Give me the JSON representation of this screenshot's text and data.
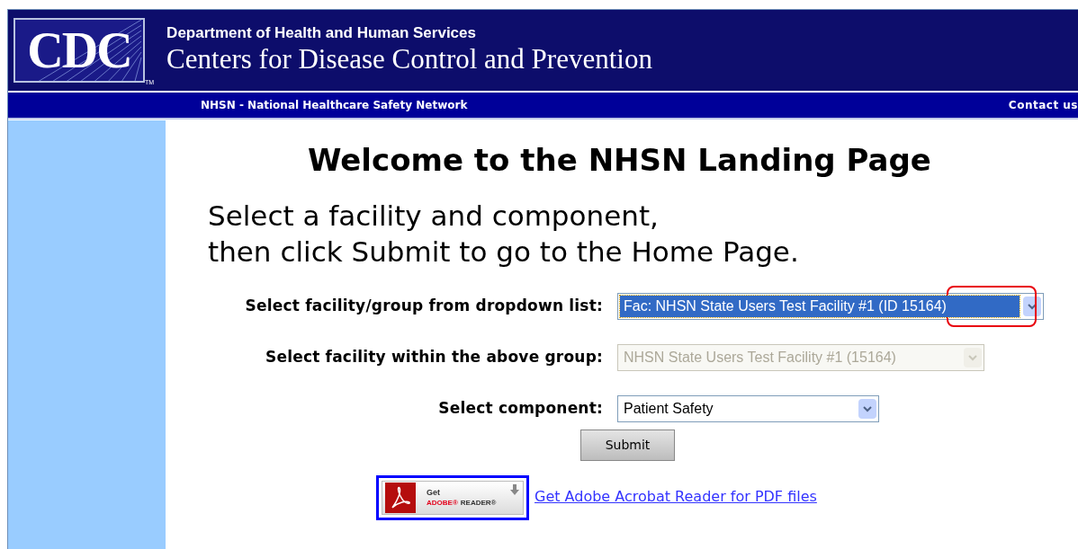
{
  "header": {
    "logo": {
      "text": "CDC",
      "tm": "TM"
    },
    "department": "Department of Health and Human Services",
    "agency": "Centers for Disease Control and Prevention"
  },
  "nav": {
    "title": "NHSN - National Healthcare Safety Network",
    "contact": "Contact us"
  },
  "page_title": "Welcome to the NHSN Landing Page",
  "instructions": [
    "Select a facility and component,",
    "then click Submit to go to the Home Page."
  ],
  "fields": [
    {
      "label": "Select facility/group from dropdown list:",
      "value": "Fac: NHSN State Users Test Facility #1 (ID 15164)",
      "disabled": false,
      "highlighted": true,
      "annotated": true
    },
    {
      "label": "Select facility within the above group:",
      "value": "NHSN State Users Test Facility #1 (15164)",
      "disabled": true,
      "highlighted": false
    },
    {
      "label": "Select component:",
      "value": "Patient Safety",
      "disabled": false,
      "highlighted": false
    }
  ],
  "submit": "Submit",
  "adobe": {
    "get": "Get",
    "brand": "ADOBE®",
    "product": "READER®",
    "link": "Get Adobe Acrobat Reader for PDF files",
    "focused": true
  }
}
